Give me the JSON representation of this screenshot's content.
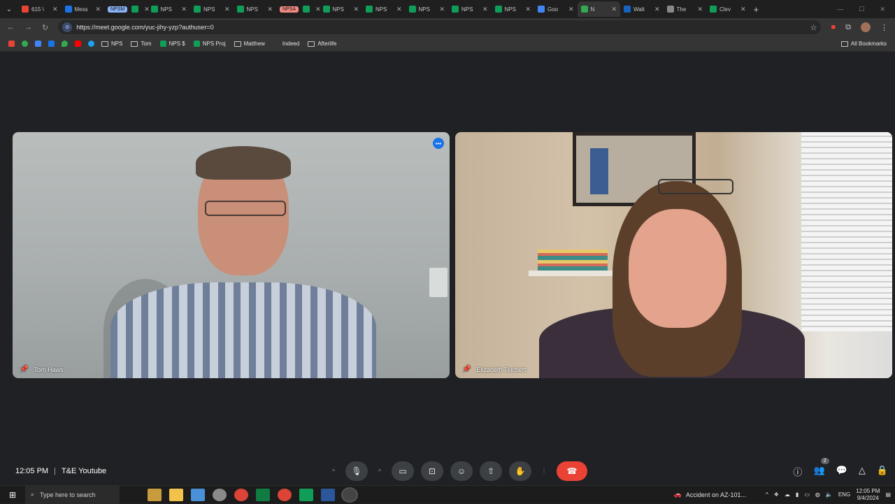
{
  "browser": {
    "tabs": [
      {
        "label": "615 \\",
        "color": "#ea4335"
      },
      {
        "label": "Mess",
        "color": "#1a73e8"
      },
      {
        "group": "NPSM",
        "group_color": "#8ab4f8",
        "label": "NPS",
        "color": "#0f9d58"
      },
      {
        "label": "NPS",
        "color": "#0f9d58"
      },
      {
        "label": "NPS",
        "color": "#0f9d58"
      },
      {
        "label": "NPS",
        "color": "#0f9d58"
      },
      {
        "group": "NPSA",
        "group_color": "#f28b82",
        "label": "NPS",
        "color": "#0f9d58"
      },
      {
        "label": "NPS",
        "color": "#0f9d58"
      },
      {
        "label": "NPS",
        "color": "#0f9d58"
      },
      {
        "label": "NPS",
        "color": "#0f9d58"
      },
      {
        "label": "NPS",
        "color": "#0f9d58"
      },
      {
        "label": "NPS",
        "color": "#0f9d58"
      },
      {
        "label": "Goo",
        "color": "#4285f4"
      },
      {
        "label": "N",
        "color": "#34a853",
        "active": true
      },
      {
        "label": "Walt",
        "color": "#1565c0"
      },
      {
        "label": "The",
        "color": "#888888"
      },
      {
        "label": "Clev",
        "color": "#0f9d58"
      }
    ],
    "new_tab": "+",
    "url": "https://meet.google.com/yuc-jihy-yzp?authuser=0",
    "bookmarks": [
      {
        "label": "NPS",
        "type": "folder"
      },
      {
        "label": "Tom",
        "type": "folder"
      },
      {
        "label": "NPS $",
        "type": "sheet"
      },
      {
        "label": "NPS Proj",
        "type": "sheet"
      },
      {
        "label": "Matthew",
        "type": "folder"
      },
      {
        "label": "Indeed",
        "type": "link"
      },
      {
        "label": "Afterlife",
        "type": "folder"
      }
    ],
    "all_bookmarks": "All Bookmarks"
  },
  "meet": {
    "participants": [
      {
        "name": "Tom Haws"
      },
      {
        "name": "Elizabeth Teichert"
      }
    ],
    "time": "12:05 PM",
    "separator": "|",
    "meeting_name": "T&E Youtube",
    "people_count": "2"
  },
  "taskbar": {
    "search_placeholder": "Type here to search",
    "news": "Accident on AZ-101...",
    "language": "ENG",
    "time": "12:05 PM",
    "date": "9/4/2024"
  }
}
